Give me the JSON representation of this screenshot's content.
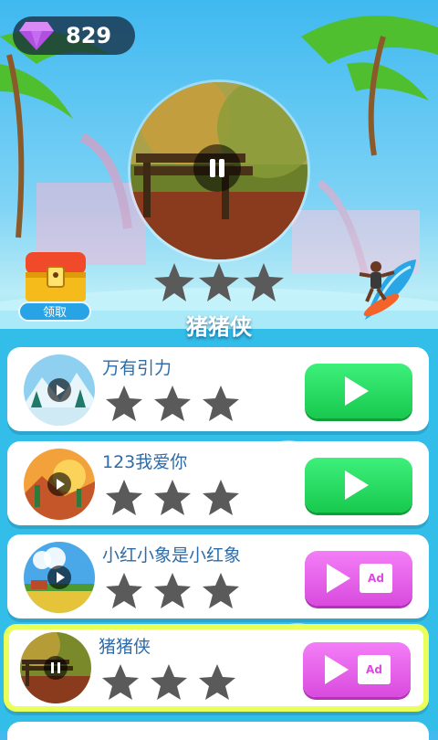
{
  "header": {
    "gem_count": "829"
  },
  "now_playing": {
    "title": "猪猪侠",
    "stars": 0,
    "state": "paused"
  },
  "chest": {
    "claim_label": "领取"
  },
  "songs": [
    {
      "title": "万有引力",
      "stars": 0,
      "action": "play",
      "thumb": "snow-mountain"
    },
    {
      "title": "123我爱你",
      "stars": 0,
      "action": "play",
      "thumb": "desert"
    },
    {
      "title": "小红小象是小红象",
      "stars": 0,
      "action": "ad-play",
      "thumb": "farm-field"
    },
    {
      "title": "猪猪侠",
      "stars": 0,
      "action": "ad-play",
      "thumb": "forest-bench",
      "current": true
    }
  ],
  "colors": {
    "play_green": "#18c94e",
    "ad_pink": "#d94bde",
    "title_blue": "#2d6ca8",
    "current_border": "#e9ff5a",
    "star_gray": "#5a5a5a"
  },
  "icons": [
    "gem-icon",
    "pause-icon",
    "star-icon",
    "treasure-chest-icon",
    "surfer-icon",
    "play-icon",
    "ad-video-icon"
  ]
}
